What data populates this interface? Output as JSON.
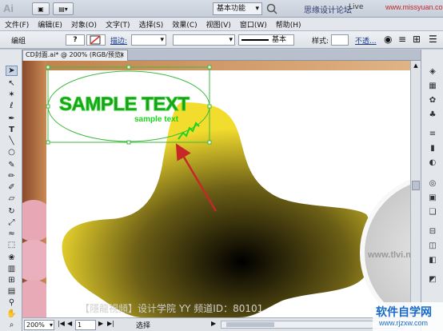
{
  "app": {
    "logo": "Ai",
    "workspace": "基本功能",
    "watermark_top": "思缘设计论坛",
    "watermark_url": "www.missyuan.com",
    "live_label": "Live"
  },
  "menu": [
    "文件(F)",
    "编辑(E)",
    "对象(O)",
    "文字(T)",
    "选择(S)",
    "效果(C)",
    "视图(V)",
    "窗口(W)",
    "帮助(H)"
  ],
  "control": {
    "group_label": "编组",
    "fill_glyph": "?",
    "stroke_label": "描边:",
    "stroke_style": "基本",
    "style_label": "样式:",
    "opacity_label": "不透..."
  },
  "document": {
    "tab_title": "CD封面.ai* @ 200% (RGB/预览)",
    "tab_close": "×"
  },
  "artwork": {
    "title": "SAMPLE TEXT",
    "subtitle": "sample text",
    "bottom_watermark": "【隱龍視頻】设计学院  YY 频道ID：80101",
    "side_watermark": "www.tlvi.ne",
    "colors": {
      "blob_outer": "#f2dc2e",
      "blob_inner": "#000000",
      "text_green": "#1fd31f",
      "arrow": "#c62828",
      "selection": "#3dbb3d"
    }
  },
  "status": {
    "zoom": "200%",
    "page": "1",
    "mode": "选择"
  },
  "watermark_corner": {
    "brand": "软件自学网",
    "url": "www.rjzxw.com"
  }
}
